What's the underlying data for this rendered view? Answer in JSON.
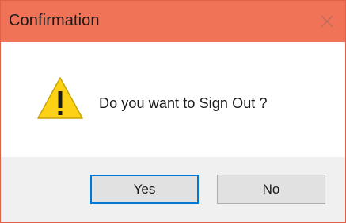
{
  "window": {
    "title": "Confirmation",
    "close_icon": "close-icon"
  },
  "message": {
    "icon": "warning-icon",
    "text": "Do you want to Sign Out ?"
  },
  "buttons": {
    "yes_label": "Yes",
    "no_label": "No",
    "default": "Yes"
  },
  "colors": {
    "titlebar": "#f07358",
    "warning_fill": "#fcd116",
    "default_button_border": "#0078d7",
    "footer": "#f0f0f0"
  }
}
